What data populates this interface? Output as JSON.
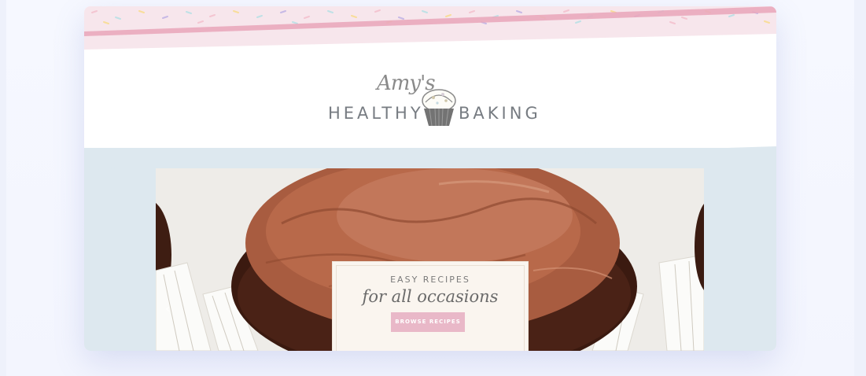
{
  "logo": {
    "script": "Amy's",
    "word_left": "HEALTHY",
    "word_right": "BAKING"
  },
  "hero": {
    "prev_icon": "‹",
    "kicker": "EASY RECIPES",
    "title": "for all occasions",
    "button_label": "BROWSE RECIPES"
  },
  "icons": {
    "cupcake": "cupcake-icon",
    "prev": "chevron-left-icon"
  },
  "colors": {
    "accent_pink": "#e9b8c8",
    "banner_pink": "#f7e6ec",
    "hero_blue": "#dde8ef",
    "text_gray": "#777c82"
  }
}
